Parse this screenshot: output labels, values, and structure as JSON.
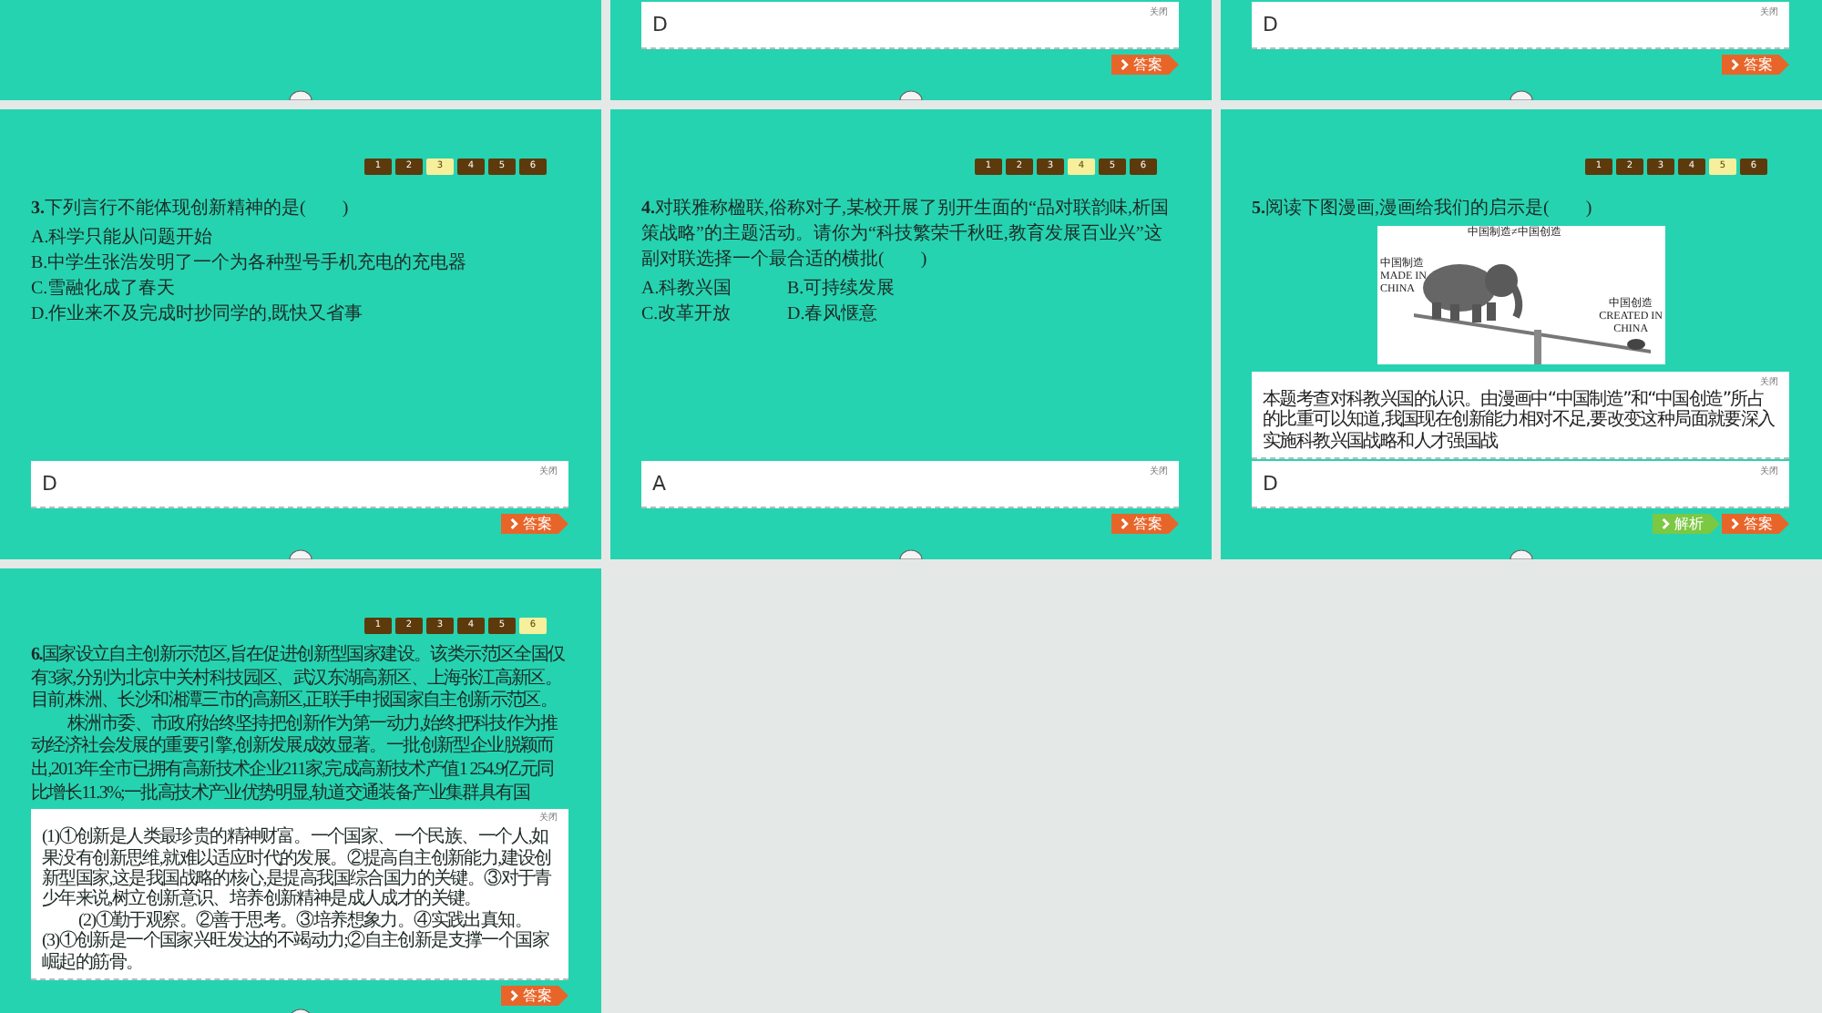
{
  "slides": [
    {
      "kind": "blank"
    },
    {
      "kind": "question",
      "answer_panel": {
        "close_label": "关闭",
        "text": "D"
      },
      "buttons": [
        {
          "kind": "answer",
          "label": "答案"
        }
      ]
    },
    {
      "kind": "question",
      "answer_panel": {
        "close_label": "关闭",
        "text": "D"
      },
      "buttons": [
        {
          "kind": "answer",
          "label": "答案"
        }
      ]
    },
    {
      "kind": "question",
      "pages": [
        {
          "label": "1",
          "selected": false
        },
        {
          "label": "2",
          "selected": false
        },
        {
          "label": "3",
          "selected": true
        },
        {
          "label": "4",
          "selected": false
        },
        {
          "label": "5",
          "selected": false
        },
        {
          "label": "6",
          "selected": false
        }
      ],
      "question": [
        "**3.**下列言行不能体现创新精神的是(　　)"
      ],
      "option_rows": [
        [
          "A.科学只能从问题开始"
        ],
        [
          "B.中学生张浩发明了一个为各种型号手机充电的充电器"
        ],
        [
          "C.雪融化成了春天"
        ],
        [
          "D.作业来不及完成时抄同学的,既快又省事"
        ]
      ],
      "answer_panel": {
        "close_label": "关闭",
        "text": "D"
      },
      "buttons": [
        {
          "kind": "answer",
          "label": "答案"
        }
      ]
    },
    {
      "kind": "question",
      "pages": [
        {
          "label": "1",
          "selected": false
        },
        {
          "label": "2",
          "selected": false
        },
        {
          "label": "3",
          "selected": false
        },
        {
          "label": "4",
          "selected": true
        },
        {
          "label": "5",
          "selected": false
        },
        {
          "label": "6",
          "selected": false
        }
      ],
      "question": [
        "**4.**对联雅称楹联,俗称对子,某校开展了别开生面的“品对联韵味,析国策战略”的主题活动。请你为“科技繁荣千秋旺,教育发展百业兴”这副对联选择一个最合适的横批(　　)"
      ],
      "option_rows": [
        [
          "A.科教兴国",
          "B.可持续发展"
        ],
        [
          "C.改革开放",
          "D.春风惬意"
        ]
      ],
      "answer_panel": {
        "close_label": "关闭",
        "text": "A"
      },
      "buttons": [
        {
          "kind": "answer",
          "label": "答案"
        }
      ]
    },
    {
      "kind": "question",
      "pages": [
        {
          "label": "1",
          "selected": false
        },
        {
          "label": "2",
          "selected": false
        },
        {
          "label": "3",
          "selected": false
        },
        {
          "label": "4",
          "selected": false
        },
        {
          "label": "5",
          "selected": true
        },
        {
          "label": "6",
          "selected": false
        }
      ],
      "question": [
        "**5.**阅读下图漫画,漫画给我们的启示是(　　)"
      ],
      "figure": {
        "top_caption": "中国制造≠中国创造",
        "left_caption": [
          "中国制造",
          "MADE IN",
          "CHINA"
        ],
        "right_caption": [
          "中国创造",
          "CREATED IN",
          "CHINA"
        ]
      },
      "explanation_panel": {
        "close_label": "关闭",
        "text": "本题考查对科教兴国的认识。由漫画中“中国制造”和“中国创造”所占的比重可以知道,我国现在创新能力相对不足,要改变这种局面就要深入实施科教兴国战略和人才强国战"
      },
      "answer_panel": {
        "close_label": "关闭",
        "text": "D"
      },
      "buttons": [
        {
          "kind": "analysis",
          "label": "解析"
        },
        {
          "kind": "answer",
          "label": "答案"
        }
      ]
    },
    {
      "kind": "question",
      "pages": [
        {
          "label": "1",
          "selected": false
        },
        {
          "label": "2",
          "selected": false
        },
        {
          "label": "3",
          "selected": false
        },
        {
          "label": "4",
          "selected": false
        },
        {
          "label": "5",
          "selected": false
        },
        {
          "label": "6",
          "selected": true
        }
      ],
      "question": [
        "**6.**国家设立自主创新示范区,旨在促进创新型国家建设。该类示范区全国仅有3家,分别为北京中关村科技园区、武汉东湖高新区、上海张江高新区。目前,株洲、长沙和湘潭三市的高新区,正联手申报国家自主创新示范区。",
        "株洲市委、市政府始终坚持把创新作为第一动力,始终把科技作为推动经济社会发展的重要引擎,创新发展成效显著。一批创新型企业脱颖而出,2013年全市已拥有高新技术企业211家,完成高新技术产值1 254.9亿元同比增长11.3%;一批高技术产业优势明显,轨道交通装备产业集群具有国"
      ],
      "answer_panel": {
        "close_label": "关闭",
        "paragraphs": [
          {
            "text": "(1)①创新是人类最珍贵的精神财富。一个国家、一个民族、一个人,如果没有创新思维,就难以适应时代的发展。②提高自主创新能力,建设创新型国家,这是我国战略的核心,是提高我国综合国力的关键。③对于青少年来说,树立创新意识、培养创新精神是成人成才的关键。",
            "indent": false
          },
          {
            "text": "(2)①勤于观察。②善于思考。③培养想象力。④实践出真知。",
            "indent": true
          },
          {
            "text": "(3)①创新是一个国家兴旺发达的不竭动力;②自主创新是支撑一个国家崛起的筋骨。",
            "indent": false
          }
        ]
      },
      "buttons": [
        {
          "kind": "answer",
          "label": "答案"
        }
      ]
    }
  ]
}
